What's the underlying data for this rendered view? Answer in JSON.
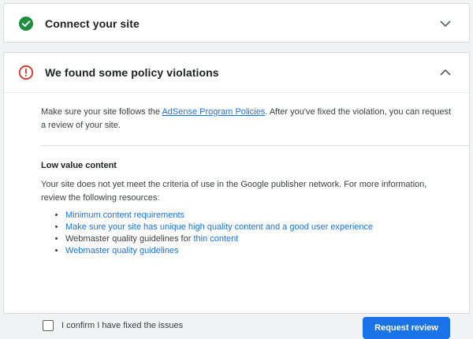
{
  "connect_section": {
    "title": "Connect your site",
    "status_icon": "check-circle-icon",
    "status_color": "#1e8e3e",
    "chevron": "chevron-down-icon"
  },
  "violations_section": {
    "title": "We found some policy violations",
    "status_icon": "error-circle-icon",
    "status_color": "#d93025",
    "chevron": "chevron-up-icon",
    "intro_before_link": "Make sure your site follows the ",
    "intro_link": "AdSense Program Policies",
    "intro_after_link": ". After you've fixed the violation, you can request a review of your site.",
    "issue_title": "Low value content",
    "issue_description": "Your site does not yet meet the criteria of use in the Google publisher network. For more information, review the following resources:",
    "resources": {
      "item1": "Minimum content requirements",
      "item2": "Make sure your site has unique high quality content and a good user experience",
      "item3_prefix": "Webmaster quality guidelines for ",
      "item3_link": "thin content",
      "item4": "Webmaster quality guidelines"
    },
    "confirm_label": "I confirm I have fixed the issues",
    "request_review_label": "Request review"
  },
  "colors": {
    "accent": "#1a73e8",
    "success": "#1e8e3e",
    "error": "#d93025"
  }
}
